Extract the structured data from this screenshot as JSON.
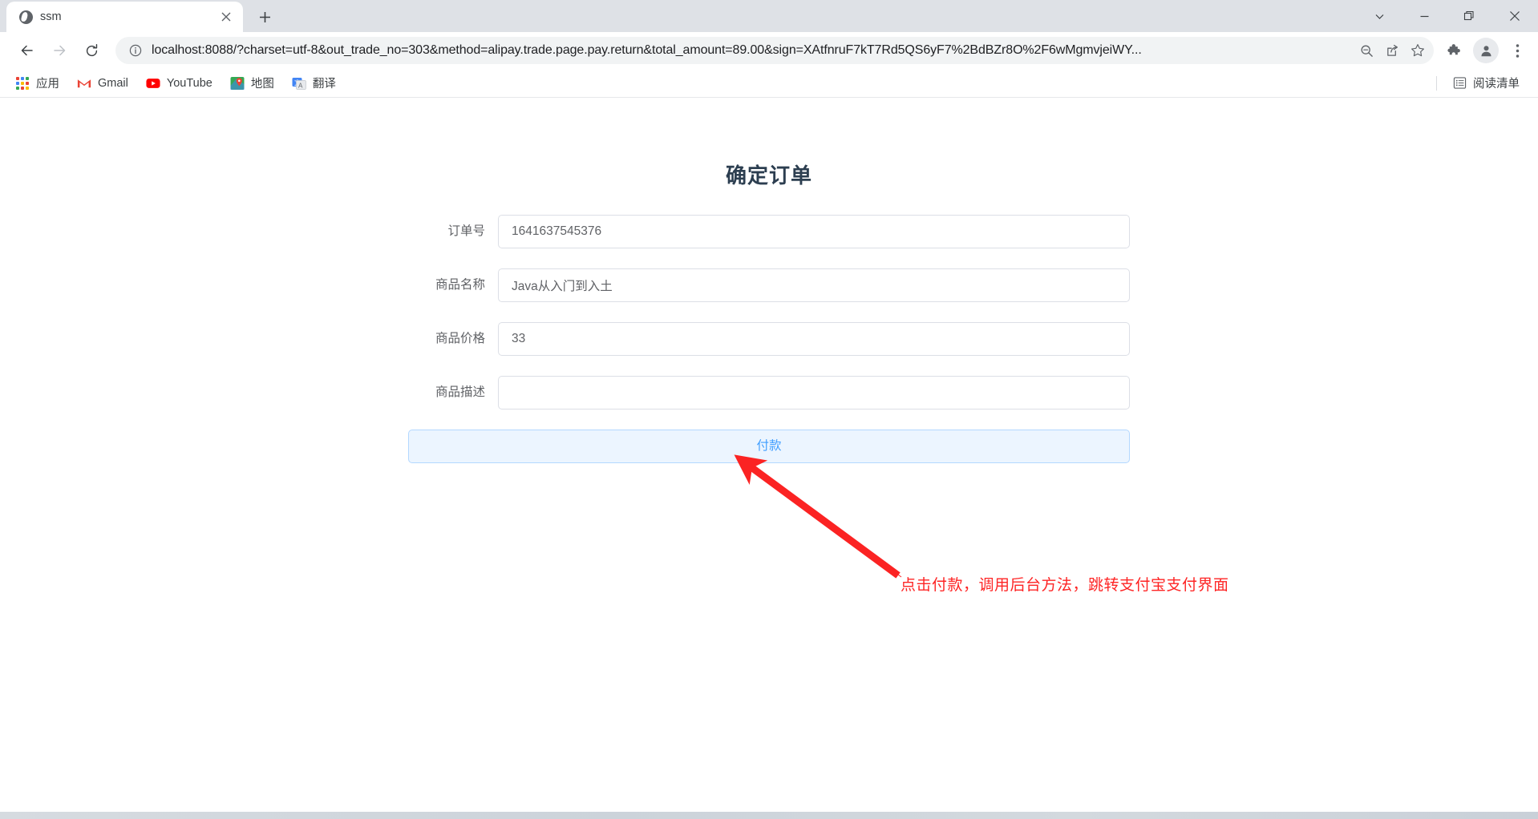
{
  "window": {
    "controls": [
      {
        "name": "chevron-down",
        "glyph": "⌄"
      },
      {
        "name": "minimize",
        "glyph": "—"
      },
      {
        "name": "restore",
        "glyph": "❐"
      },
      {
        "name": "close",
        "glyph": "✕"
      }
    ]
  },
  "tabs": [
    {
      "title": "ssm",
      "favicon": "globe-icon",
      "close_label": "✕"
    }
  ],
  "newtab_label": "+",
  "toolbar": {
    "back_label": "←",
    "forward_label": "→",
    "reload_label": "⟳",
    "url_scheme": "localhost:8088",
    "url_rest": "/?charset=utf-8&out_trade_no=303&method=alipay.trade.page.pay.return&total_amount=89.00&sign=XAtfnruF7kT7Rd5QS6yF7%2BdBZr8O%2F6wMgmvjeiWY...",
    "url_full": "localhost:8088/?charset=utf-8&out_trade_no=303&method=alipay.trade.page.pay.return&total_amount=89.00&sign=XAtfnruF7kT7Rd5QS6yF7%2BdBZr8O%2F6wMgmvjeiWY...",
    "info_icon": "info-circle-icon",
    "zoom_icon": "zoom-out-icon",
    "share_icon": "share-icon",
    "bookmark_icon": "star-icon",
    "extensions_icon": "puzzle-icon",
    "profile_icon": "account-avatar-icon",
    "menu_icon": "three-dot-menu-icon"
  },
  "bookmarks": {
    "items": [
      {
        "label": "应用",
        "icon": "apps-grid-icon"
      },
      {
        "label": "Gmail",
        "icon": "gmail-icon"
      },
      {
        "label": "YouTube",
        "icon": "youtube-icon"
      },
      {
        "label": "地图",
        "icon": "maps-icon"
      },
      {
        "label": "翻译",
        "icon": "translate-icon"
      }
    ],
    "reading_list": {
      "label": "阅读清单",
      "icon": "reading-list-icon"
    }
  },
  "content": {
    "title": "确定订单",
    "fields": [
      {
        "label": "订单号",
        "value": "1641637545376",
        "placeholder": ""
      },
      {
        "label": "商品名称",
        "value": "Java从入门到入土",
        "placeholder": ""
      },
      {
        "label": "商品价格",
        "value": "33",
        "placeholder": ""
      },
      {
        "label": "商品描述",
        "value": "",
        "placeholder": ""
      }
    ],
    "pay_button": "付款"
  },
  "annotation": {
    "text": "点击付款，调用后台方法，跳转支付宝支付界面",
    "color": "#fe2424"
  },
  "colors": {
    "accent": "#409eff",
    "button_bg": "#ecf5ff",
    "button_border": "#b3d8ff",
    "title": "#2c3e50",
    "input_border": "#dcdfe6",
    "tabstrip": "#dee1e6",
    "omnibox": "#f1f3f4"
  }
}
